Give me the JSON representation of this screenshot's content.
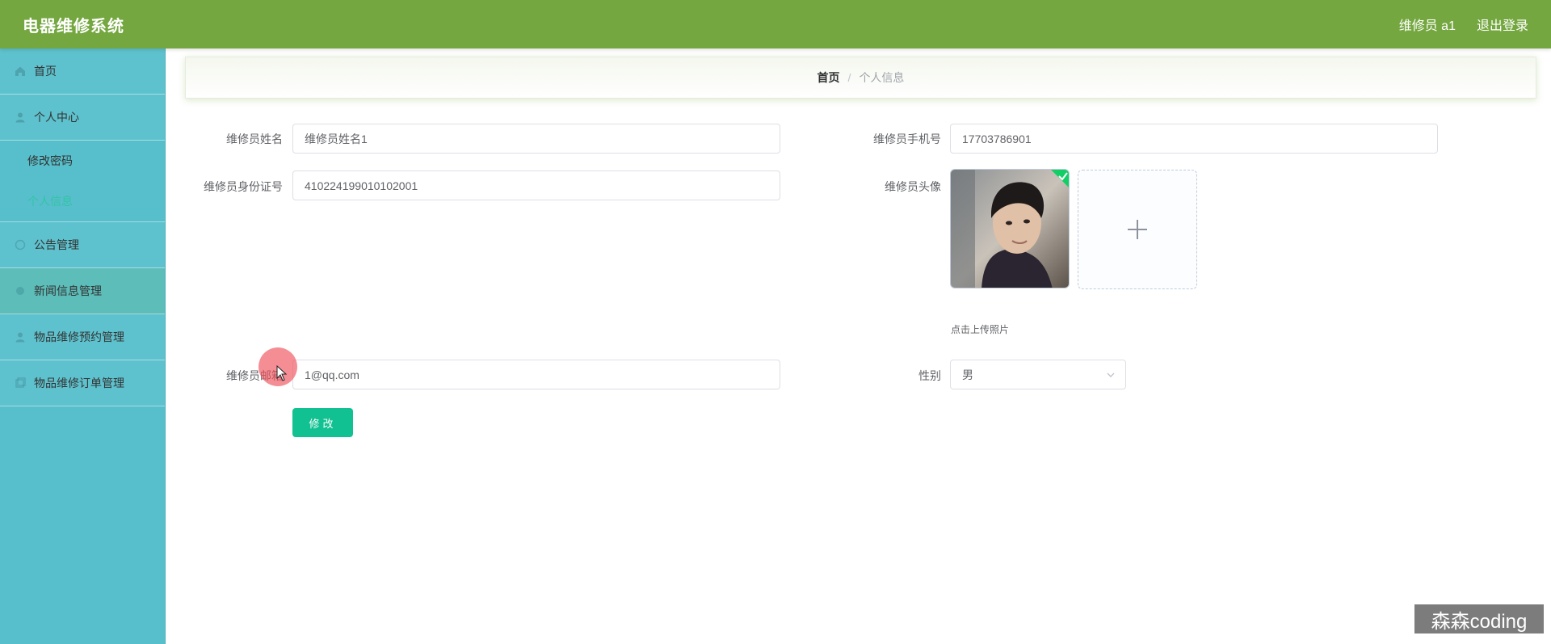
{
  "header": {
    "app_title": "电器维修系统",
    "user_label": "维修员 a1",
    "logout_label": "退出登录"
  },
  "sidebar": {
    "items": [
      {
        "label": "首页",
        "icon": "home-icon"
      },
      {
        "label": "个人中心",
        "icon": "user-icon",
        "children": [
          {
            "label": "修改密码",
            "active": false
          },
          {
            "label": "个人信息",
            "active": true
          }
        ]
      },
      {
        "label": "公告管理",
        "icon": "notice-icon"
      },
      {
        "label": "新闻信息管理",
        "icon": "news-icon"
      },
      {
        "label": "物品维修预约管理",
        "icon": "user-icon"
      },
      {
        "label": "物品维修订单管理",
        "icon": "order-icon"
      }
    ]
  },
  "breadcrumb": {
    "home": "首页",
    "separator": "/",
    "current": "个人信息"
  },
  "form": {
    "name_label": "维修员姓名",
    "name_value": "维修员姓名1",
    "phone_label": "维修员手机号",
    "phone_value": "17703786901",
    "idcard_label": "维修员身份证号",
    "idcard_value": "410224199010102001",
    "avatar_label": "维修员头像",
    "upload_tip": "点击上传照片",
    "email_label": "维修员邮箱",
    "email_value": "1@qq.com",
    "gender_label": "性别",
    "gender_value": "男",
    "submit_label": "修改"
  },
  "watermark": "森森coding",
  "colors": {
    "header": "#74a73f",
    "sidebar": "#57bfcb",
    "active_menu_text": "#34c3a7",
    "primary_button": "#11c191"
  }
}
